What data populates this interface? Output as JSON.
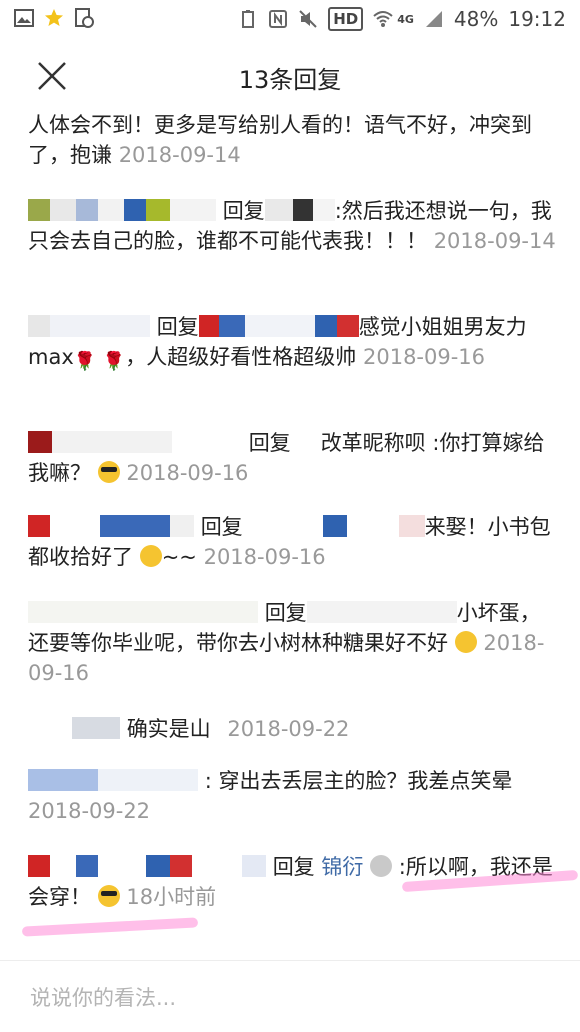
{
  "status_bar": {
    "network": "4G",
    "hd": "HD",
    "battery": "48%",
    "time": "19:12"
  },
  "header": {
    "title": "13条回复"
  },
  "comments": [
    {
      "text": "人体会不到！更多是写给别人看的！语气不好，冲突到了，抱谦",
      "time": "2018-09-14"
    },
    {
      "reply_label": "回复",
      "text": ":然后我还想说一句，我只会去自己的脸，谁都不可能代表我！！！",
      "time": "2018-09-14"
    },
    {
      "reply_label": "回复",
      "text_a": "感觉小姐姐男友力max",
      "text_b": "，人超级好看性格超级帅",
      "time": "2018-09-16"
    },
    {
      "reply_label": "回复",
      "text_a": "改革昵称呗",
      "text_b": " :你打算嫁给我嘛？",
      "time": "2018-09-16"
    },
    {
      "reply_label": "回复",
      "text_a": "来娶！小书包都收拾好了",
      "text_b": "~~",
      "time": "2018-09-16"
    },
    {
      "reply_label": "回复",
      "text_a": "小坏蛋，还要等你毕业呢，带你去小树林种糖果好不好",
      "time": "2018-09-16"
    },
    {
      "text": "确实是山",
      "time": "2018-09-22"
    },
    {
      "text": ": 穿出去丢层主的脸？我差点笑晕",
      "time": "2018-09-22"
    },
    {
      "reply_label": "回复",
      "name": "锦衍",
      "text_a": " :所以啊，我还是会穿！",
      "time": "18小时前"
    }
  ],
  "input": {
    "placeholder": "说说你的看法..."
  },
  "colors": {
    "name_link": "#3f6aa6",
    "timestamp": "#999999",
    "highlight": "#ff8ad7"
  }
}
